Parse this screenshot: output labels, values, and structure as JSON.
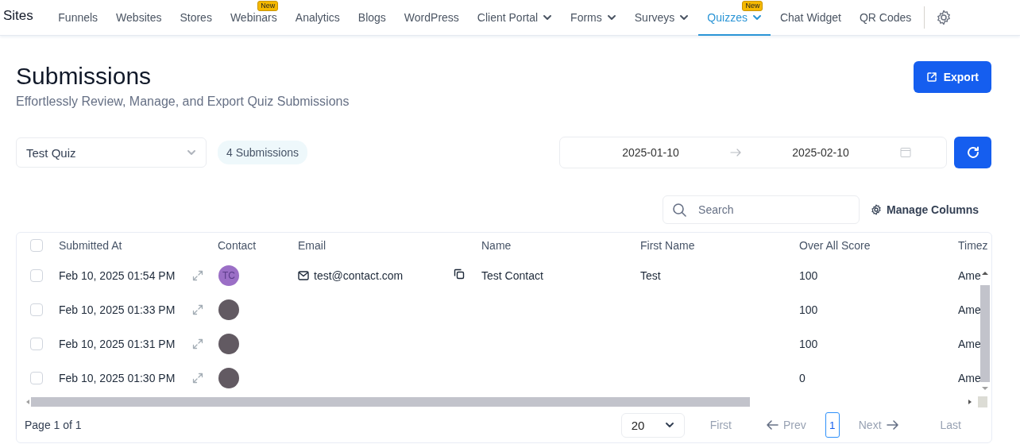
{
  "nav": {
    "brand": "Sites",
    "items": [
      {
        "label": "Funnels",
        "selected": false,
        "dropdown": false
      },
      {
        "label": "Websites",
        "selected": false,
        "dropdown": false
      },
      {
        "label": "Stores",
        "selected": false,
        "dropdown": false
      },
      {
        "label": "Webinars",
        "selected": false,
        "dropdown": false,
        "badge": "New"
      },
      {
        "label": "Analytics",
        "selected": false,
        "dropdown": false
      },
      {
        "label": "Blogs",
        "selected": false,
        "dropdown": false
      },
      {
        "label": "WordPress",
        "selected": false,
        "dropdown": false
      },
      {
        "label": "Client Portal",
        "selected": false,
        "dropdown": true
      },
      {
        "label": "Forms",
        "selected": false,
        "dropdown": true
      },
      {
        "label": "Surveys",
        "selected": false,
        "dropdown": true
      },
      {
        "label": "Quizzes",
        "selected": true,
        "dropdown": true,
        "badge": "New"
      },
      {
        "label": "Chat Widget",
        "selected": false,
        "dropdown": false
      },
      {
        "label": "QR Codes",
        "selected": false,
        "dropdown": false
      }
    ]
  },
  "header": {
    "title": "Submissions",
    "subtitle": "Effortlessly Review, Manage, and Export Quiz Submissions",
    "export_button": "Export"
  },
  "filters": {
    "quiz_select": "Test Quiz",
    "count_badge": "4 Submissions",
    "date_from": "2025-01-10",
    "date_to": "2025-02-10"
  },
  "toolbar": {
    "search_placeholder": "Search",
    "manage_columns": "Manage Columns"
  },
  "table": {
    "select_all_checked": false,
    "columns": [
      "Submitted At",
      "Contact",
      "Email",
      "Name",
      "First Name",
      "Over All Score",
      "Timez"
    ],
    "rows": [
      {
        "checked": false,
        "submitted_at": "Feb 10, 2025 01:54 PM",
        "contact": {
          "initials": "TC",
          "color": "#9b6fc6"
        },
        "email": "test@contact.com",
        "name": "Test Contact",
        "first_name": "Test",
        "score": "100",
        "timezone": "Ame"
      },
      {
        "checked": false,
        "submitted_at": "Feb 10, 2025 01:33 PM",
        "contact": {
          "color": "#625a62"
        },
        "score": "100",
        "timezone": "Ame"
      },
      {
        "checked": false,
        "submitted_at": "Feb 10, 2025 01:31 PM",
        "contact": {
          "color": "#625a62"
        },
        "score": "100",
        "timezone": "Ame"
      },
      {
        "checked": false,
        "submitted_at": "Feb 10, 2025 01:30 PM",
        "contact": {
          "color": "#625a62"
        },
        "score": "0",
        "timezone": "Ame"
      }
    ]
  },
  "pagination": {
    "page_info": "Page 1 of 1",
    "page_size": "20",
    "first": {
      "label": "First",
      "disabled": true
    },
    "prev": {
      "label": "Prev",
      "disabled": true
    },
    "pages": [
      {
        "label": "1",
        "selected": true
      }
    ],
    "next": {
      "label": "Next",
      "disabled": true
    },
    "last": {
      "label": "Last",
      "disabled": true
    }
  }
}
